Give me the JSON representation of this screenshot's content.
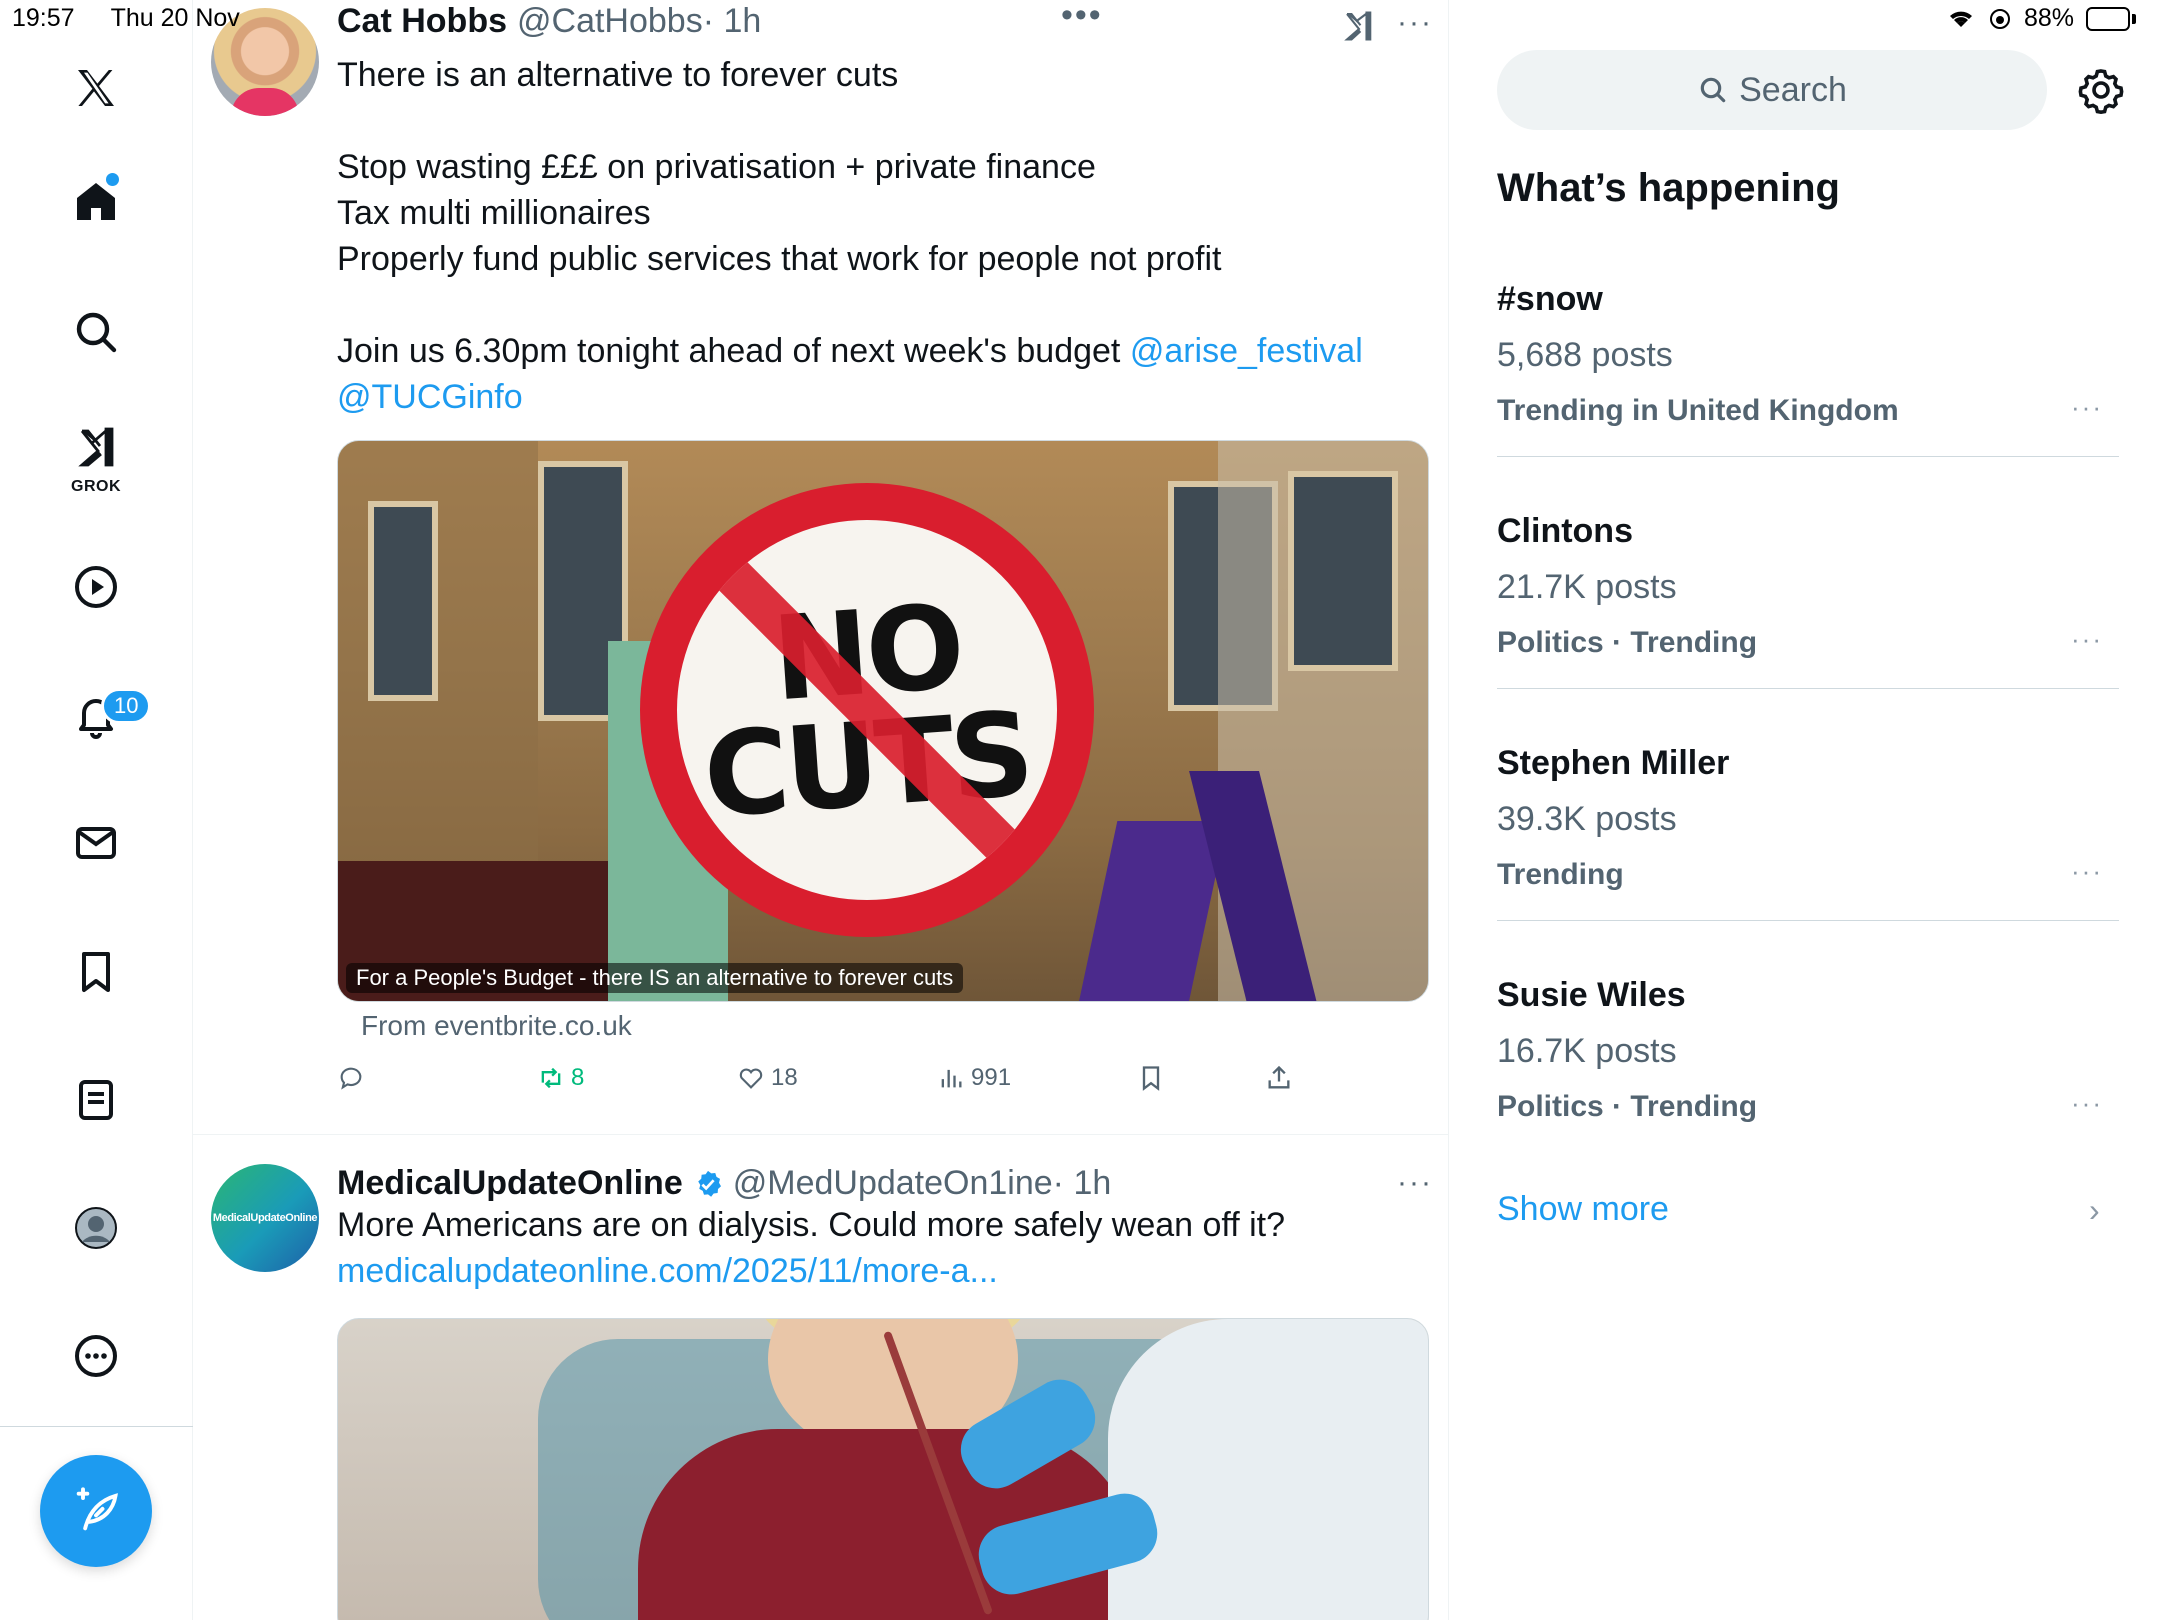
{
  "status_bar": {
    "time": "19:57",
    "date": "Thu 20 Nov",
    "battery": "88%",
    "battery_level": 0.88,
    "icons": [
      "wifi-icon",
      "focus-icon",
      "battery-icon"
    ]
  },
  "nav": {
    "items": [
      "x-logo",
      "home",
      "explore",
      "grok",
      "video",
      "notifications",
      "messages",
      "bookmarks",
      "lists",
      "profile",
      "more"
    ],
    "grok_label": "GROK",
    "notifications_badge": "10",
    "compose_label": "Post"
  },
  "tweets": [
    {
      "name": "Cat Hobbs",
      "handle": "@CatHobbs",
      "time": "· 1h",
      "lines": [
        "There is an alternative to forever cuts",
        "",
        "Stop wasting £££ on privatisation + private finance",
        "Tax multi millionaires",
        "Properly fund public services that work for people not profit",
        ""
      ],
      "line_last_text": "Join us 6.30pm tonight ahead of next week's budget ",
      "mention1": "@arise_festival",
      "mention2": "@TUCGinfo",
      "card": {
        "sign_line1": "NO",
        "sign_line2": "CUTS",
        "caption": "For a People's Budget - there IS an alternative to forever cuts",
        "source": "From eventbrite.co.uk"
      },
      "actions": {
        "replies": "",
        "reposts": "8",
        "likes": "18",
        "views": "991"
      }
    },
    {
      "name": "MedicalUpdateOnline",
      "handle": "@MedUpdateOn1ine",
      "time": "· 1h",
      "avatar_text": "MedicalUpdateOnline",
      "text": "More Americans are on dialysis. Could more safely wean off it?",
      "link": "medicalupdateonline.com/2025/11/more-a..."
    }
  ],
  "sidebar": {
    "search_placeholder": "Search",
    "title": "What’s happening",
    "trends": [
      {
        "name": "#snow",
        "posts": "5,688 posts",
        "category": "Trending in United Kingdom"
      },
      {
        "name": "Clintons",
        "posts": "21.7K posts",
        "category": "Politics · Trending"
      },
      {
        "name": "Stephen Miller",
        "posts": "39.3K posts",
        "category": "Trending"
      },
      {
        "name": "Susie Wiles",
        "posts": "16.7K posts",
        "category": "Politics · Trending"
      }
    ],
    "show_more": "Show more"
  },
  "colors": {
    "accent": "#1d9bf0",
    "repost_green": "#00ba7c",
    "secondary_text": "#536471"
  }
}
